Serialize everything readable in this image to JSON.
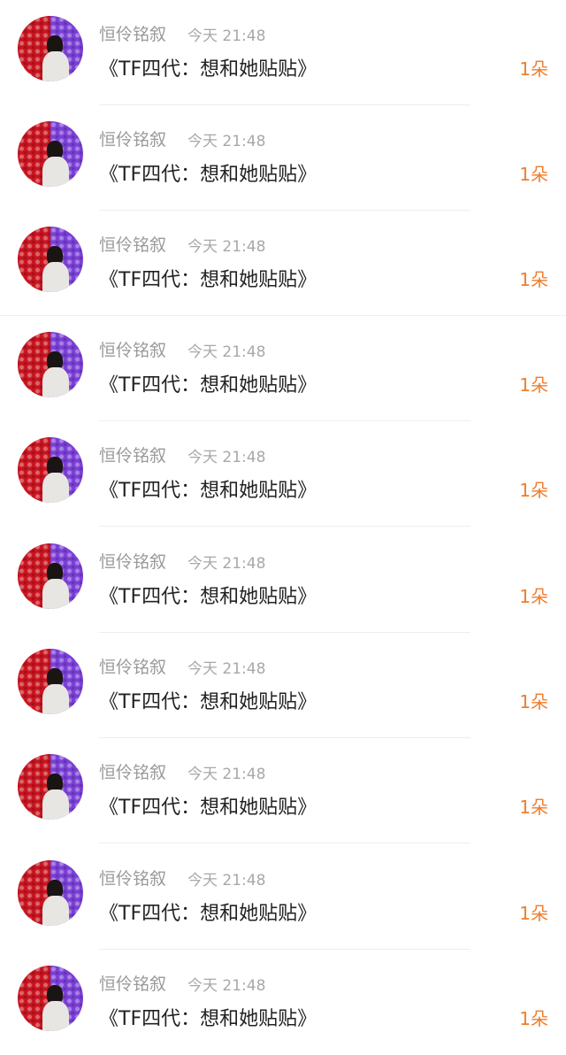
{
  "items": [
    {
      "name": "恒伶铭叙",
      "time": "今天 21:48",
      "title": "《TF四代：想和她贴贴》",
      "count": "1朵",
      "avatar_icon": "user-avatar-icon"
    },
    {
      "name": "恒伶铭叙",
      "time": "今天 21:48",
      "title": "《TF四代：想和她贴贴》",
      "count": "1朵",
      "avatar_icon": "user-avatar-icon"
    },
    {
      "name": "恒伶铭叙",
      "time": "今天 21:48",
      "title": "《TF四代：想和她贴贴》",
      "count": "1朵",
      "avatar_icon": "user-avatar-icon"
    },
    {
      "name": "恒伶铭叙",
      "time": "今天 21:48",
      "title": "《TF四代：想和她贴贴》",
      "count": "1朵",
      "avatar_icon": "user-avatar-icon"
    },
    {
      "name": "恒伶铭叙",
      "time": "今天 21:48",
      "title": "《TF四代：想和她贴贴》",
      "count": "1朵",
      "avatar_icon": "user-avatar-icon"
    },
    {
      "name": "恒伶铭叙",
      "time": "今天 21:48",
      "title": "《TF四代：想和她贴贴》",
      "count": "1朵",
      "avatar_icon": "user-avatar-icon"
    },
    {
      "name": "恒伶铭叙",
      "time": "今天 21:48",
      "title": "《TF四代：想和她贴贴》",
      "count": "1朵",
      "avatar_icon": "user-avatar-icon"
    },
    {
      "name": "恒伶铭叙",
      "time": "今天 21:48",
      "title": "《TF四代：想和她贴贴》",
      "count": "1朵",
      "avatar_icon": "user-avatar-icon"
    },
    {
      "name": "恒伶铭叙",
      "time": "今天 21:48",
      "title": "《TF四代：想和她贴贴》",
      "count": "1朵",
      "avatar_icon": "user-avatar-icon"
    },
    {
      "name": "恒伶铭叙",
      "time": "今天 21:48",
      "title": "《TF四代：想和她贴贴》",
      "count": "1朵",
      "avatar_icon": "user-avatar-icon"
    }
  ],
  "colors": {
    "accent": "#ef7d2d",
    "name_text": "#9a9a9a",
    "title_text": "#222222"
  }
}
